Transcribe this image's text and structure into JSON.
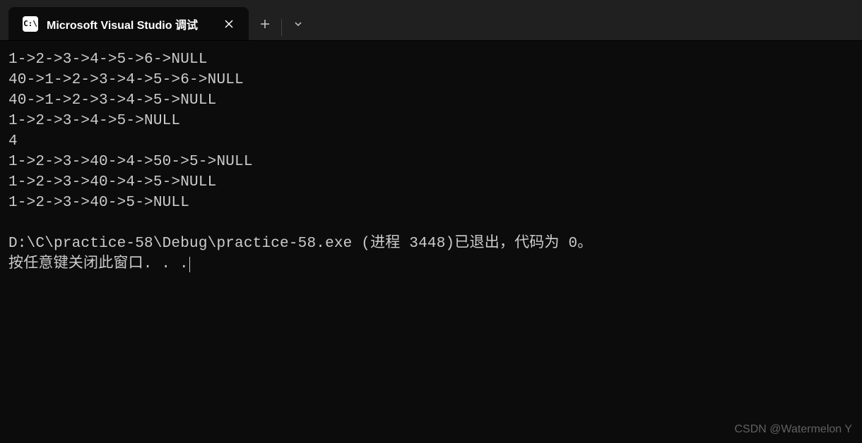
{
  "tab": {
    "icon_label": "C:\\",
    "title": "Microsoft Visual Studio 调试"
  },
  "terminal": {
    "lines": [
      "1->2->3->4->5->6->NULL",
      "40->1->2->3->4->5->6->NULL",
      "40->1->2->3->4->5->NULL",
      "1->2->3->4->5->NULL",
      "4",
      "1->2->3->40->4->50->5->NULL",
      "1->2->3->40->4->5->NULL",
      "1->2->3->40->5->NULL",
      "",
      "D:\\C\\practice-58\\Debug\\practice-58.exe (进程 3448)已退出，代码为 0。",
      "按任意键关闭此窗口. . ."
    ]
  },
  "watermark": "CSDN @Watermelon Y"
}
